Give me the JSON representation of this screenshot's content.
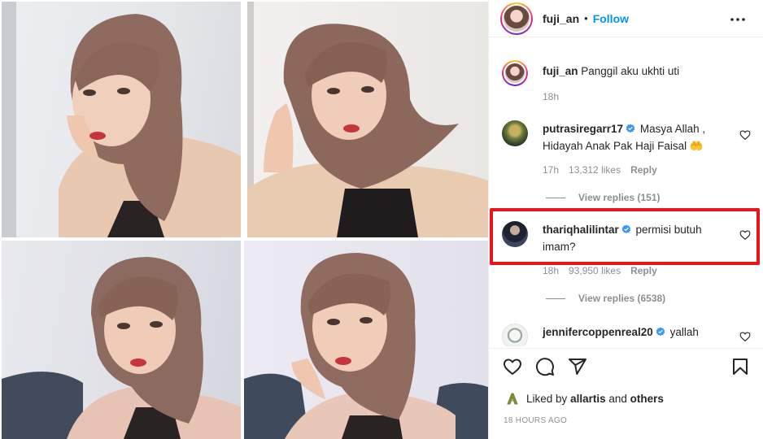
{
  "post": {
    "username": "fuji_an",
    "separator": "•",
    "follow_label": "Follow",
    "more_label": "More options"
  },
  "caption": {
    "username": "fuji_an",
    "text": "Panggil aku ukhti uti",
    "time": "18h"
  },
  "comments": [
    {
      "username": "putrasiregarr17",
      "verified": true,
      "text": "Masya Allah , Hidayah Anak Pak Haji Faisal 🤲",
      "time": "17h",
      "likes": "13,312 likes",
      "reply_label": "Reply",
      "view_replies": "View replies (151)"
    },
    {
      "username": "thariqhalilintar",
      "verified": true,
      "text": "permisi butuh imam?",
      "time": "18h",
      "likes": "93,950 likes",
      "reply_label": "Reply",
      "view_replies": "View replies (6538)",
      "highlighted": true
    },
    {
      "username": "jennifercoppenreal20",
      "verified": true,
      "text": "yallah"
    }
  ],
  "actions": {
    "like": "heart-icon",
    "comment": "comment-icon",
    "share": "paper-plane-icon",
    "save": "bookmark-icon"
  },
  "likes_summary": {
    "prefix": "Liked by",
    "user": "allartis",
    "connector": "and",
    "suffix": "others"
  },
  "timestamp": "18 HOURS AGO",
  "colors": {
    "accent": "#0095f6",
    "verified": "#3897f0",
    "highlight_box": "#e8141b",
    "muted": "#8e8e8e"
  }
}
